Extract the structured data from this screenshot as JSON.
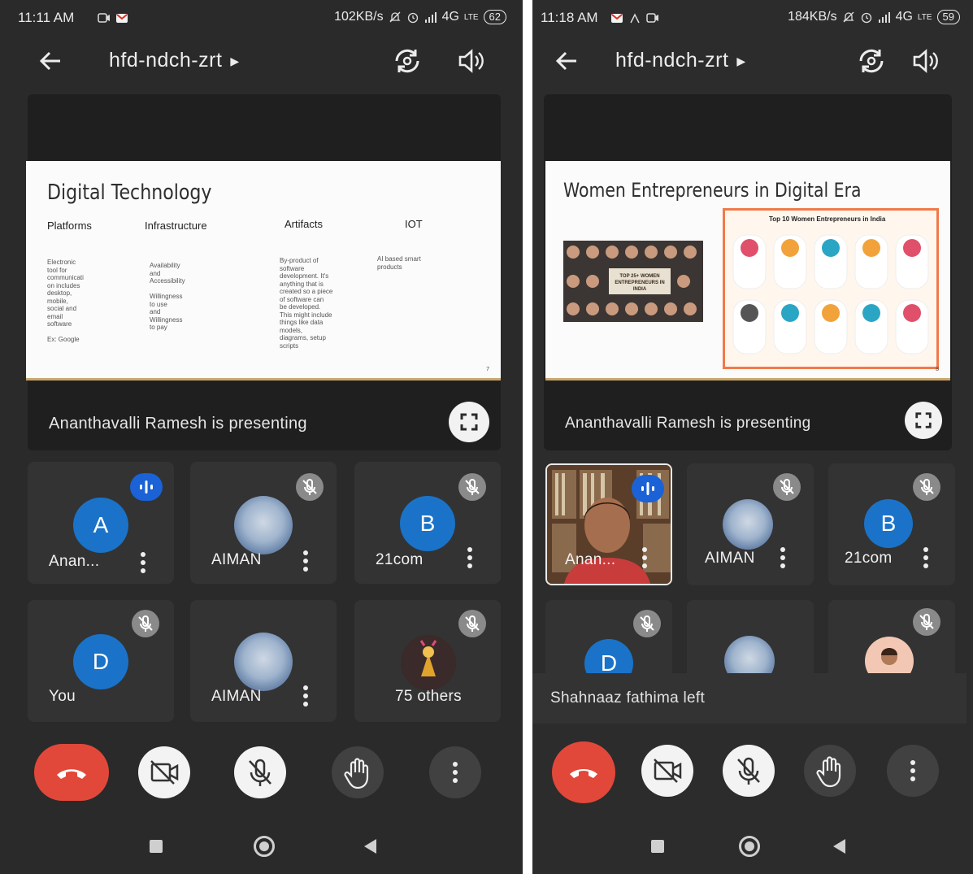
{
  "left_screen": {
    "status": {
      "time": "11:11 AM",
      "speed": "102KB/s",
      "network": "4G",
      "lte": "LTE",
      "battery": "62"
    },
    "meeting_code": "hfd-ndch-zrt",
    "slide": {
      "title": "Digital Technology",
      "columns": [
        {
          "heading": "Platforms",
          "text": "Electronic\ntool for\ncommunicati\non includes\ndesktop,\nmobile,\nsocial and\nemail\nsoftware\n\nEx: Google"
        },
        {
          "heading": "Infrastructure",
          "text": "Availability\nand\nAccessibility\n\nWillingness\nto use\nand\nWillingness\nto pay"
        },
        {
          "heading": "Artifacts",
          "text": "By-product of\nsoftware\ndevelopment. It's\nanything that is\ncreated so a piece\nof software can\nbe developed.\nThis might include\nthings like data\nmodels,\ndiagrams, setup\nscripts"
        },
        {
          "heading": "IOT",
          "text": "AI based smart\nproducts"
        }
      ],
      "page_number": "7"
    },
    "presenting_text": "Ananthavalli Ramesh is presenting",
    "participants": [
      {
        "name": "Anan...",
        "initial": "A",
        "avatar": "letter",
        "state": "speaking"
      },
      {
        "name": "AIMAN",
        "initial": "",
        "avatar": "image",
        "state": "muted"
      },
      {
        "name": "21com",
        "initial": "B",
        "avatar": "letter",
        "state": "muted"
      },
      {
        "name": "You",
        "initial": "D",
        "avatar": "letter",
        "state": "muted"
      },
      {
        "name": "AIMAN",
        "initial": "",
        "avatar": "image",
        "state": "none"
      },
      {
        "name": "75 others",
        "initial": "",
        "avatar": "photo",
        "state": "muted"
      }
    ]
  },
  "right_screen": {
    "status": {
      "time": "11:18 AM",
      "speed": "184KB/s",
      "network": "4G",
      "lte": "LTE",
      "battery": "59"
    },
    "meeting_code": "hfd-ndch-zrt",
    "slide": {
      "title": "Women Entrepreneurs in Digital Era",
      "collage_caption": "TOP 25+ WOMEN ENTREPRENEURS IN INDIA",
      "poster_title": "Top 10 Women Entrepreneurs in India",
      "page_number": "8"
    },
    "presenting_text": "Ananthavalli Ramesh is presenting",
    "participants": [
      {
        "name": "Anan...",
        "avatar": "video",
        "state": "speaking"
      },
      {
        "name": "AIMAN",
        "avatar": "image",
        "state": "muted"
      },
      {
        "name": "21com",
        "initial": "B",
        "avatar": "letter",
        "state": "muted"
      },
      {
        "name": "",
        "initial": "D",
        "avatar": "letter",
        "state": "muted"
      },
      {
        "name": "",
        "avatar": "image",
        "state": "none"
      },
      {
        "name": "",
        "avatar": "photo",
        "state": "muted"
      }
    ],
    "toast": "Shahnaaz fathima left"
  },
  "controls": [
    "end-call",
    "camera-off",
    "mic-off",
    "raise-hand",
    "more-options"
  ],
  "colors": {
    "end_call": "#e2483a",
    "speaking": "#1a62d6",
    "avatar_blue": "#1a73c8",
    "background": "#2b2b2b"
  }
}
